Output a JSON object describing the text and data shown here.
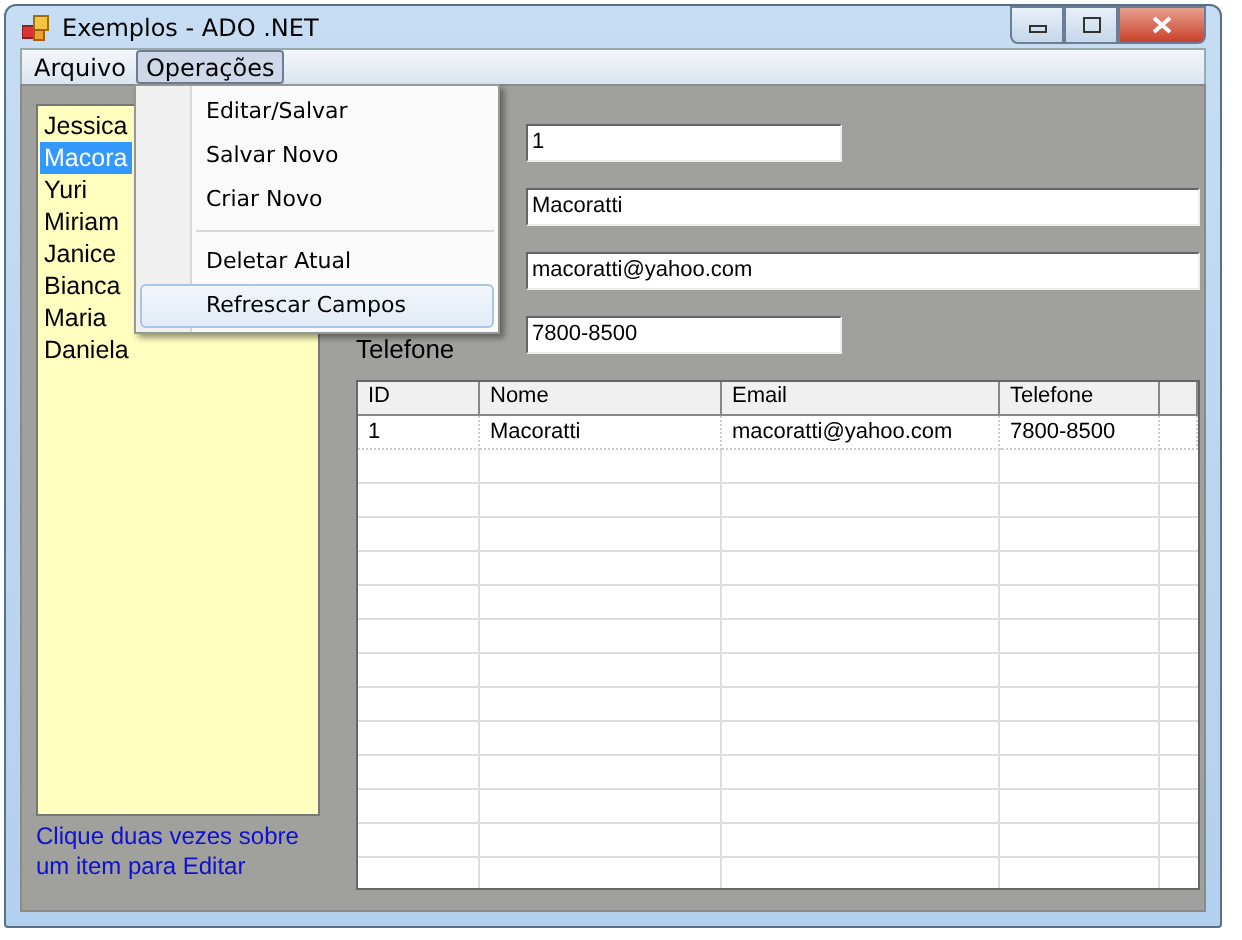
{
  "window": {
    "title": "Exemplos - ADO .NET"
  },
  "menu_bar": [
    {
      "label": "Arquivo",
      "selected": false
    },
    {
      "label": "Operações",
      "selected": true
    }
  ],
  "dropdown": [
    {
      "kind": "item",
      "label": "Editar/Salvar",
      "selected": false
    },
    {
      "kind": "item",
      "label": "Salvar Novo",
      "selected": false
    },
    {
      "kind": "item",
      "label": "Criar Novo",
      "selected": false
    },
    {
      "kind": "separator"
    },
    {
      "kind": "item",
      "label": "Deletar Atual",
      "selected": false
    },
    {
      "kind": "item",
      "label": "Refrescar Campos",
      "selected": true
    }
  ],
  "list": {
    "items": [
      {
        "text": "Jessica",
        "selected": false
      },
      {
        "text": "Macora",
        "selected": true
      },
      {
        "text": "Yuri",
        "selected": false
      },
      {
        "text": "Miriam",
        "selected": false
      },
      {
        "text": "Janice",
        "selected": false
      },
      {
        "text": "Bianca",
        "selected": false
      },
      {
        "text": "Maria",
        "selected": false
      },
      {
        "text": "Daniela",
        "selected": false
      }
    ],
    "hint": "Clique duas vezes sobre um item para Editar"
  },
  "fields": [
    {
      "kind": "short",
      "value": "1"
    },
    {
      "kind": "long",
      "value": "Macoratti"
    },
    {
      "kind": "long",
      "value": "macoratti@yahoo.com"
    },
    {
      "kind": "short",
      "label": "Telefone",
      "value": "7800-8500"
    }
  ],
  "table": {
    "columns": [
      "ID",
      "Nome",
      "Email",
      "Telefone"
    ],
    "rows": [
      [
        "1",
        "Macoratti",
        "macoratti@yahoo.com",
        "7800-8500"
      ]
    ]
  }
}
